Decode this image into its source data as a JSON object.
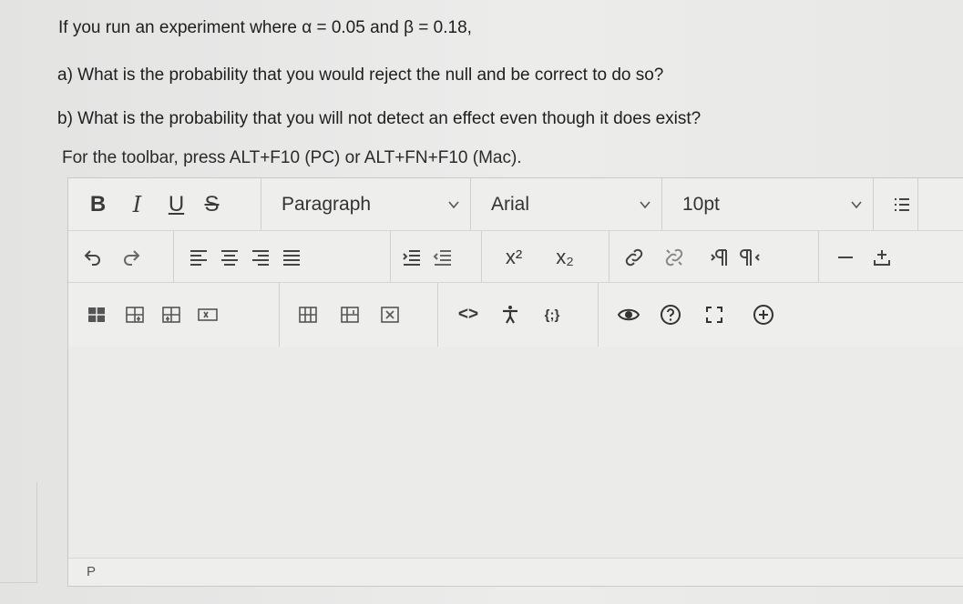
{
  "question": {
    "line1": "If you run an experiment where α = 0.05 and β = 0.18,",
    "part_a": "a) What is the probability that you would reject the null and be correct to do so?",
    "part_b": "b) What is the probability that you will not detect an effect even though it does exist?"
  },
  "editor": {
    "hint": "For the toolbar, press ALT+F10 (PC) or ALT+FN+F10 (Mac).",
    "format": {
      "bold": "B",
      "italic": "I",
      "underline": "U",
      "strike": "S"
    },
    "block_format": "Paragraph",
    "font_family": "Arial",
    "font_size": "10pt",
    "superscript": "x²",
    "subscript": "x₂",
    "code": "<>",
    "embed": "{;}",
    "status_path": "P"
  }
}
